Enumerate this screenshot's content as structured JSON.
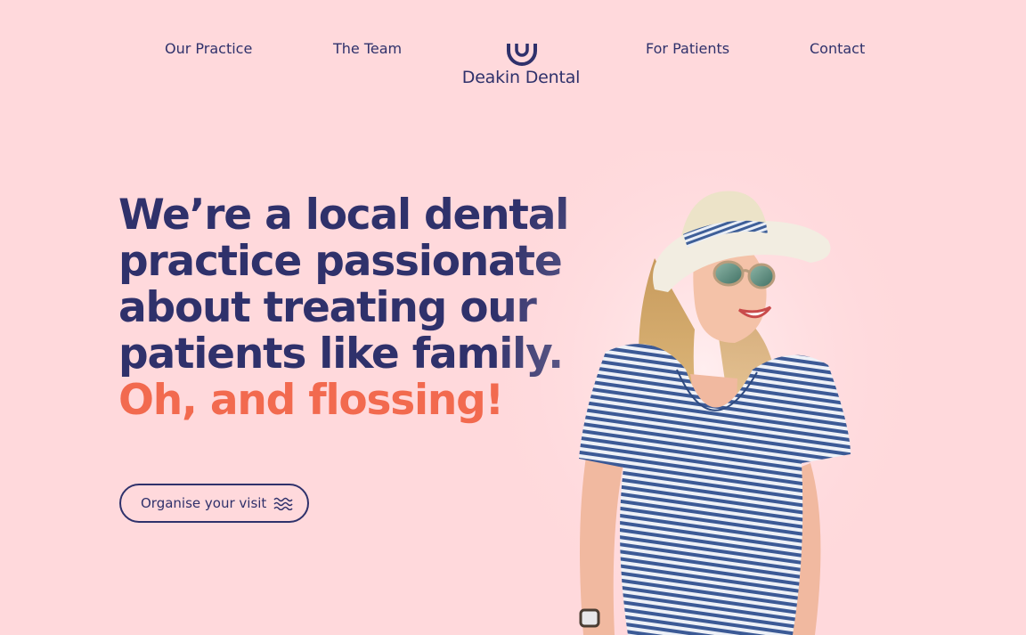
{
  "nav": {
    "left_items": [
      {
        "label": "Our Practice"
      },
      {
        "label": "The Team"
      }
    ],
    "right_items": [
      {
        "label": "For Patients"
      },
      {
        "label": "Contact"
      }
    ],
    "logo": {
      "text": "Deakin Dental",
      "icon": "smile-tooth-icon"
    }
  },
  "hero": {
    "heading_lines": [
      "We’re a local dental",
      "practice passionate",
      "about treating our",
      "patients like family."
    ],
    "heading_accent": "Oh, and flossing!",
    "cta": {
      "label": "Organise your visit",
      "icon": "wave-lines-icon"
    },
    "image": {
      "icon": "smiling-woman-photo"
    }
  },
  "colors": {
    "background": "#ffd9dc",
    "primary": "#2f316b",
    "accent": "#f26a4f"
  }
}
